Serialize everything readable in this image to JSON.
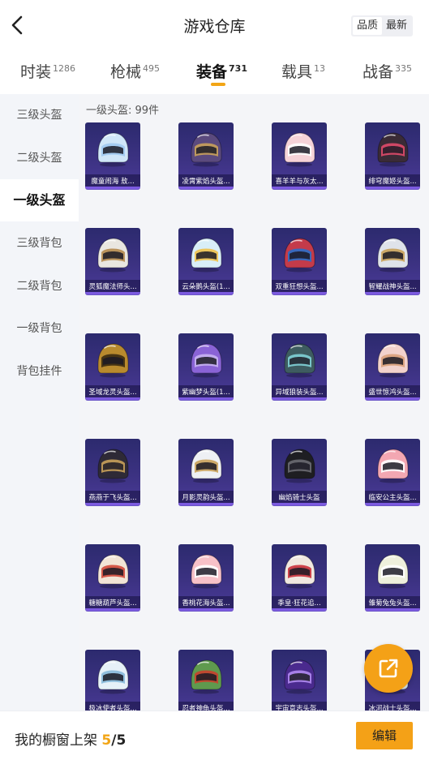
{
  "header": {
    "title": "游戏仓库",
    "sort_options": [
      {
        "label": "品质",
        "active": true
      },
      {
        "label": "最新",
        "active": false
      }
    ]
  },
  "tabs": [
    {
      "label": "时装",
      "count": "1286",
      "active": false
    },
    {
      "label": "枪械",
      "count": "495",
      "active": false
    },
    {
      "label": "装备",
      "count": "731",
      "active": true
    },
    {
      "label": "载具",
      "count": "13",
      "active": false
    },
    {
      "label": "战备",
      "count": "335",
      "active": false
    }
  ],
  "sidebar": {
    "items": [
      {
        "label": "三级头盔",
        "active": false
      },
      {
        "label": "二级头盔",
        "active": false
      },
      {
        "label": "一级头盔",
        "active": true
      },
      {
        "label": "三级背包",
        "active": false
      },
      {
        "label": "二级背包",
        "active": false
      },
      {
        "label": "一级背包",
        "active": false
      },
      {
        "label": "背包挂件",
        "active": false
      }
    ]
  },
  "content": {
    "section_title": "一级头盔: 99件",
    "items": [
      {
        "name": "魔童闹海 敖...",
        "color": "#cfe6f8",
        "accent": "#9ec9ef"
      },
      {
        "name": "凌霄紫焰头盔...",
        "color": "#5b4a7e",
        "accent": "#c9a15a"
      },
      {
        "name": "喜羊羊与灰太...",
        "color": "#f6d3d8",
        "accent": "#ffffff"
      },
      {
        "name": "绯穹魔姬头盔...",
        "color": "#3a2b36",
        "accent": "#e04a6a"
      },
      {
        "name": "灵狐魔法师头...",
        "color": "#e9e6e0",
        "accent": "#b58a4e"
      },
      {
        "name": "云朵鹅头盔(1...",
        "color": "#d8eef8",
        "accent": "#f0c14a"
      },
      {
        "name": "双重狂想头盔...",
        "color": "#c43b4a",
        "accent": "#2a6fc9"
      },
      {
        "name": "智耀战神头盔...",
        "color": "#dfe3ea",
        "accent": "#c9a15a"
      },
      {
        "name": "圣域龙灵头盔...",
        "color": "#b88a2e",
        "accent": "#3a2a12"
      },
      {
        "name": "紫幽梦头盔(1...",
        "color": "#8a63d6",
        "accent": "#c7b2f2"
      },
      {
        "name": "异域狼装头盔...",
        "color": "#3e5c60",
        "accent": "#7fd0d6"
      },
      {
        "name": "盛世惊鸿头盔...",
        "color": "#f2d2cc",
        "accent": "#d9a07a"
      },
      {
        "name": "燕燕于飞头盔...",
        "color": "#2e2a36",
        "accent": "#c9a15a"
      },
      {
        "name": "月影灵韵头盔...",
        "color": "#eef0f4",
        "accent": "#c9a15a"
      },
      {
        "name": "幽焰骑士头盔",
        "color": "#1e1e22",
        "accent": "#6a6a72"
      },
      {
        "name": "临安公主头盔...",
        "color": "#f3a7b2",
        "accent": "#ffffff"
      },
      {
        "name": "糖糖葫芦头盔...",
        "color": "#f2e4d6",
        "accent": "#d2483a"
      },
      {
        "name": "香桃花海头盔...",
        "color": "#f7c1c8",
        "accent": "#ffffff"
      },
      {
        "name": "季皇·狂花追...",
        "color": "#f0e8e0",
        "accent": "#c9303a"
      },
      {
        "name": "雏菊兔兔头盔...",
        "color": "#eef0dc",
        "accent": "#ffffff"
      },
      {
        "name": "极冰使者头盔...",
        "color": "#e6f1f8",
        "accent": "#86b9d9"
      },
      {
        "name": "忍者神龟头盔...",
        "color": "#5f9a4e",
        "accent": "#c9402e"
      },
      {
        "name": "宇宙意志头盔...",
        "color": "#4a2a8e",
        "accent": "#b08af0"
      },
      {
        "name": "冰河战士头盔...",
        "color": "#dfe8ee",
        "accent": "#8fb0c4"
      }
    ]
  },
  "fab": {
    "icon": "share-external-icon"
  },
  "bottom": {
    "shelf_label": "我的橱窗上架 ",
    "shelf_current": "5",
    "shelf_total": "/5",
    "edit_label": "编辑"
  }
}
